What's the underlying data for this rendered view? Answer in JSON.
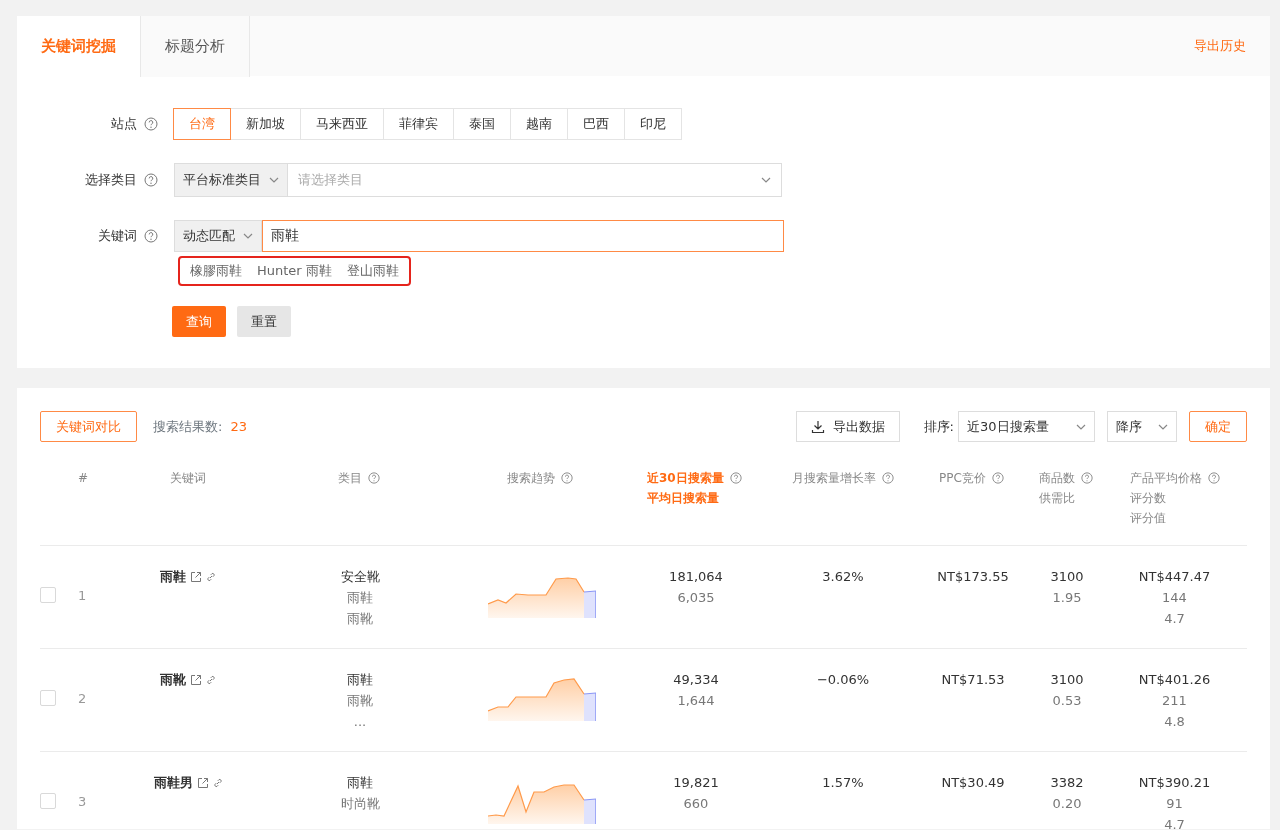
{
  "tabs": [
    {
      "label": "关键词挖掘",
      "selected": true
    },
    {
      "label": "标题分析",
      "selected": false
    }
  ],
  "export_history": "导出历史",
  "form": {
    "site": {
      "label": "站点",
      "options": [
        {
          "label": "台湾",
          "selected": true
        },
        {
          "label": "新加坡",
          "selected": false
        },
        {
          "label": "马来西亚",
          "selected": false
        },
        {
          "label": "菲律宾",
          "selected": false
        },
        {
          "label": "泰国",
          "selected": false
        },
        {
          "label": "越南",
          "selected": false
        },
        {
          "label": "巴西",
          "selected": false
        },
        {
          "label": "印尼",
          "selected": false
        }
      ]
    },
    "category": {
      "label": "选择类目",
      "type_select": "平台标准类目",
      "placeholder": "请选择类目"
    },
    "keyword": {
      "label": "关键词",
      "match_select": "动态匹配",
      "value": "雨鞋",
      "suggestions": [
        "橡膠雨鞋",
        "Hunter 雨鞋",
        "登山雨鞋"
      ],
      "suggestions_outlined": true
    },
    "buttons": [
      {
        "label": "查询",
        "kind": "primary"
      },
      {
        "label": "重置",
        "kind": "secondary"
      }
    ]
  },
  "results": {
    "compare_button": "关键词对比",
    "count_label": "搜索结果数:",
    "count": "23",
    "export_button": "导出数据",
    "sort_label": "排序:",
    "sort_field": "近30日搜索量",
    "sort_order": "降序",
    "confirm_button": "确定"
  },
  "columns": [
    {
      "lines": [
        "#"
      ],
      "help": false,
      "highlighted": false
    },
    {
      "lines": [
        "关键词"
      ],
      "help": false,
      "highlighted": false
    },
    {
      "lines": [
        "类目"
      ],
      "help": true,
      "highlighted": false
    },
    {
      "lines": [
        "搜索趋势"
      ],
      "help": true,
      "highlighted": false
    },
    {
      "lines": [
        "近30日搜索量",
        "平均日搜索量"
      ],
      "help": true,
      "highlighted": true
    },
    {
      "lines": [
        "月搜索量增长率"
      ],
      "help": true,
      "highlighted": false
    },
    {
      "lines": [
        "PPC竞价"
      ],
      "help": true,
      "highlighted": false
    },
    {
      "lines": [
        "商品数",
        "供需比"
      ],
      "help": true,
      "highlighted": false
    },
    {
      "lines": [
        "产品平均价格",
        "评分数",
        "评分值"
      ],
      "help": true,
      "highlighted": false
    }
  ],
  "rows": [
    {
      "checked": false,
      "index": "1",
      "keyword": "雨鞋",
      "categories": [
        "安全靴",
        "雨鞋",
        "雨靴"
      ],
      "search_30d": "181,064",
      "daily_avg": "6,035",
      "growth": "3.62%",
      "ppc": "NT$173.55",
      "goods_count": "3100",
      "supply_ratio": "1.95",
      "avg_price": "NT$447.47",
      "rating_count": "144",
      "rating": "4.7"
    },
    {
      "checked": false,
      "index": "2",
      "keyword": "雨靴",
      "categories": [
        "雨鞋",
        "雨靴",
        "..."
      ],
      "search_30d": "49,334",
      "daily_avg": "1,644",
      "growth": "−0.06%",
      "ppc": "NT$71.53",
      "goods_count": "3100",
      "supply_ratio": "0.53",
      "avg_price": "NT$401.26",
      "rating_count": "211",
      "rating": "4.8"
    },
    {
      "checked": false,
      "index": "3",
      "keyword": "雨鞋男",
      "categories": [
        "雨鞋",
        "时尚靴"
      ],
      "search_30d": "19,821",
      "daily_avg": "660",
      "growth": "1.57%",
      "ppc": "NT$30.49",
      "goods_count": "3382",
      "supply_ratio": "0.20",
      "avg_price": "NT$390.21",
      "rating_count": "91",
      "rating": "4.7"
    }
  ]
}
